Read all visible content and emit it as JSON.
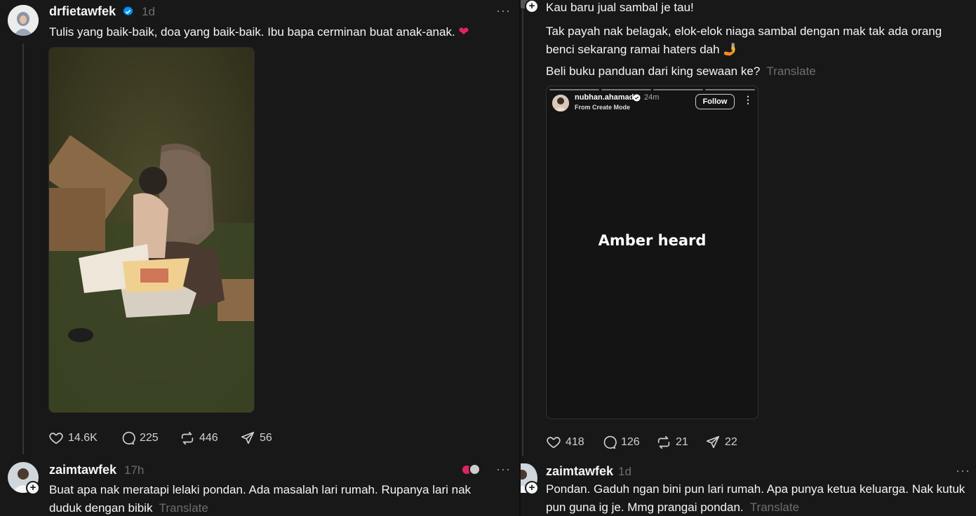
{
  "left_post": {
    "username": "drfietawfek",
    "time": "1d",
    "more": "···",
    "text": "Tulis yang baik-baik, doa yang baik-baik. Ibu bapa cerminan buat anak-anak.",
    "emoji": "❤️",
    "likes": "14.6K",
    "comments": "225",
    "reposts": "446",
    "shares": "56"
  },
  "left_reply": {
    "username": "zaimtawfek",
    "time": "17h",
    "more": "···",
    "text_line1": "Buat apa nak meratapi lelaki pondan. Ada masalah lari rumah. Rupanya lari nak",
    "text_line2": "duduk dengan bibik",
    "translate": "Translate"
  },
  "right_post": {
    "line1": "Kau baru jual sambal je tau!",
    "line2": "Tak payah nak belagak, elok-elok niaga sambal dengan mak tak ada orang",
    "line3": "benci sekarang ramai haters dah",
    "line3_emoji": "🤳",
    "line4": "Beli buku panduan dari king sewaan ke?",
    "translate": "Translate",
    "embed": {
      "username": "nubhan.ahamad",
      "time": "24m",
      "mode": "From Create Mode",
      "follow": "Follow",
      "caption": "Amber heard"
    },
    "likes": "418",
    "comments": "126",
    "reposts": "21",
    "shares": "22"
  },
  "right_reply": {
    "username": "zaimtawfek",
    "time": "1d",
    "more": "···",
    "text_line1": "Pondan. Gaduh ngan bini pun lari rumah. Apa punya ketua keluarga. Nak kutuk",
    "text_line2": "pun guna ig je. Mmg prangai pondan.",
    "translate": "Translate"
  },
  "colors": {
    "background": "#181818",
    "text": "#f3f5f7",
    "muted": "#6e6e6e",
    "verified": "#0095f6",
    "heart": "#e0245e"
  },
  "icons": [
    "heart-icon",
    "comment-icon",
    "repost-icon",
    "share-icon",
    "verified-icon",
    "plus-icon",
    "more-icon"
  ]
}
